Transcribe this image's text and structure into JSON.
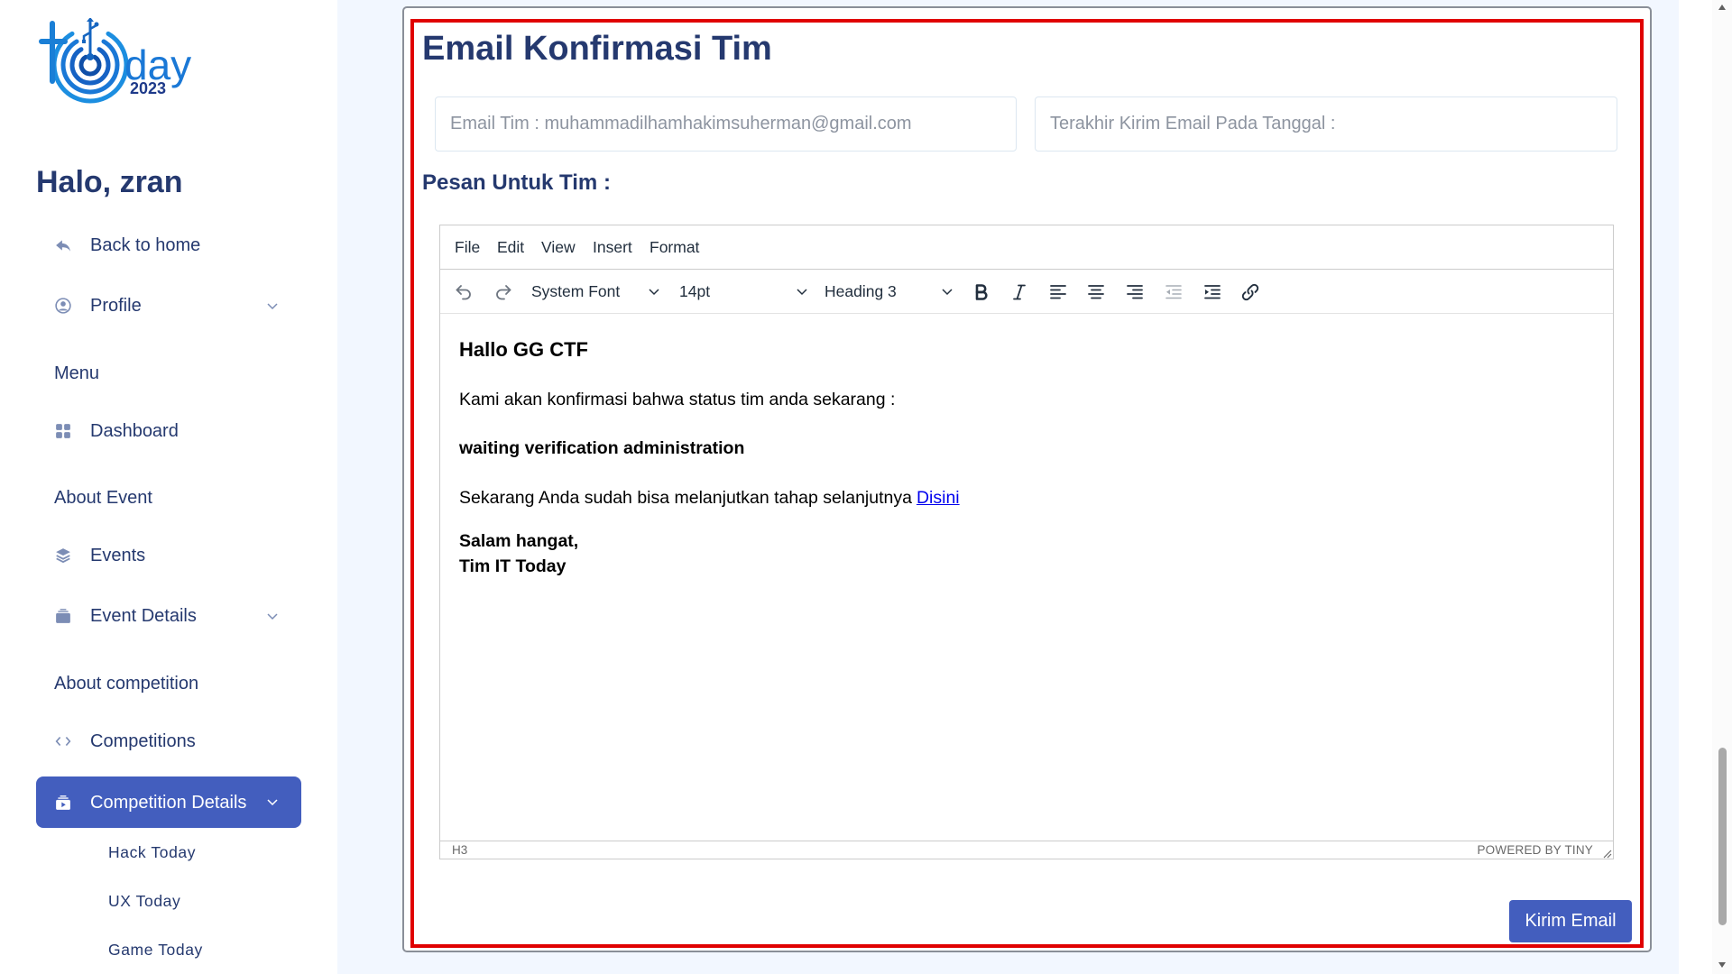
{
  "logo": {
    "word": "day",
    "year": "2023"
  },
  "sidebar": {
    "greeting": "Halo, zran",
    "back_home": {
      "label": "Back to home",
      "icon": "reply-icon"
    },
    "profile": {
      "label": "Profile",
      "icon": "person-circle-icon",
      "expandable": true
    },
    "sections": [
      {
        "header": "Menu",
        "items": [
          {
            "label": "Dashboard",
            "icon": "grid-icon"
          }
        ]
      },
      {
        "header": "About Event",
        "items": [
          {
            "label": "Events",
            "icon": "stack-icon"
          },
          {
            "label": "Event Details",
            "icon": "collection-icon",
            "expandable": true
          }
        ]
      },
      {
        "header": "About competition",
        "items": [
          {
            "label": "Competitions",
            "icon": "code-icon"
          },
          {
            "label": "Competition Details",
            "icon": "collection-play-icon",
            "expandable": true,
            "active": true,
            "subitems": [
              "Hack Today",
              "UX Today",
              "Game Today"
            ]
          }
        ]
      }
    ]
  },
  "page": {
    "title": "Email Konfirmasi Tim",
    "email_field": {
      "placeholder": "Email Tim : muhammadilhamhakimsuherman@gmail.com"
    },
    "last_sent_field": {
      "placeholder": "Terakhir Kirim Email Pada Tanggal :"
    },
    "message_label": "Pesan Untuk Tim :",
    "submit_label": "Kirim Email"
  },
  "editor": {
    "menubar": [
      "File",
      "Edit",
      "View",
      "Insert",
      "Format"
    ],
    "toolbar": {
      "font_family": "System Font",
      "font_size": "14pt",
      "block_format": "Heading 3",
      "icons": [
        "undo-icon",
        "redo-icon",
        "bold-icon",
        "italic-icon",
        "align-left-icon",
        "align-center-icon",
        "align-right-icon",
        "outdent-icon",
        "indent-icon",
        "link-icon"
      ]
    },
    "content": {
      "heading": "Hallo GG CTF",
      "intro": "Kami akan konfirmasi bahwa status tim anda sekarang :",
      "status": "waiting verification administration",
      "next_step": "Sekarang Anda sudah bisa melanjutkan tahap selanjutnya",
      "link_text": "Disini",
      "closing": "Salam hangat,",
      "signature": "Tim IT Today"
    },
    "statusbar": {
      "path": "H3",
      "branding": "POWERED BY TINY"
    }
  },
  "colors": {
    "primary": "#435ebe",
    "heading": "#25396f",
    "highlight": "#e00000",
    "page_bg": "#f2f7ff",
    "link": "#0000ee"
  }
}
